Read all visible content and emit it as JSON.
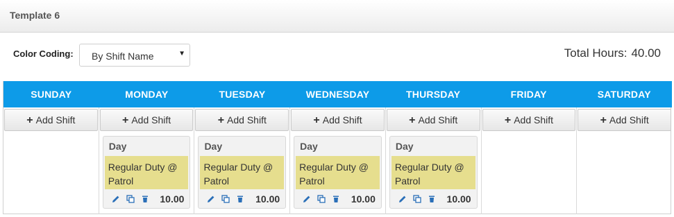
{
  "header": {
    "title": "Template 6"
  },
  "controls": {
    "color_coding_label": "Color Coding:",
    "color_coding_value": "By Shift Name",
    "total_hours_label": "Total Hours:",
    "total_hours_value": "40.00"
  },
  "colors": {
    "header_blue": "#0d9be8",
    "shift_yellow": "#e6de8e"
  },
  "days": [
    {
      "name": "SUNDAY",
      "add_label": "Add Shift",
      "shifts": []
    },
    {
      "name": "MONDAY",
      "add_label": "Add Shift",
      "shifts": [
        {
          "type": "Day",
          "name": "Regular Duty @ Patrol",
          "hours": "10.00"
        }
      ]
    },
    {
      "name": "TUESDAY",
      "add_label": "Add Shift",
      "shifts": [
        {
          "type": "Day",
          "name": "Regular Duty @ Patrol",
          "hours": "10.00"
        }
      ]
    },
    {
      "name": "WEDNESDAY",
      "add_label": "Add Shift",
      "shifts": [
        {
          "type": "Day",
          "name": "Regular Duty @ Patrol",
          "hours": "10.00"
        }
      ]
    },
    {
      "name": "THURSDAY",
      "add_label": "Add Shift",
      "shifts": [
        {
          "type": "Day",
          "name": "Regular Duty @ Patrol",
          "hours": "10.00"
        }
      ]
    },
    {
      "name": "FRIDAY",
      "add_label": "Add Shift",
      "shifts": []
    },
    {
      "name": "SATURDAY",
      "add_label": "Add Shift",
      "shifts": []
    }
  ],
  "icons": {
    "add": "plus-icon",
    "edit": "pencil-icon",
    "copy": "copy-icon",
    "delete": "trash-icon",
    "dropdown": "caret-down-icon"
  }
}
